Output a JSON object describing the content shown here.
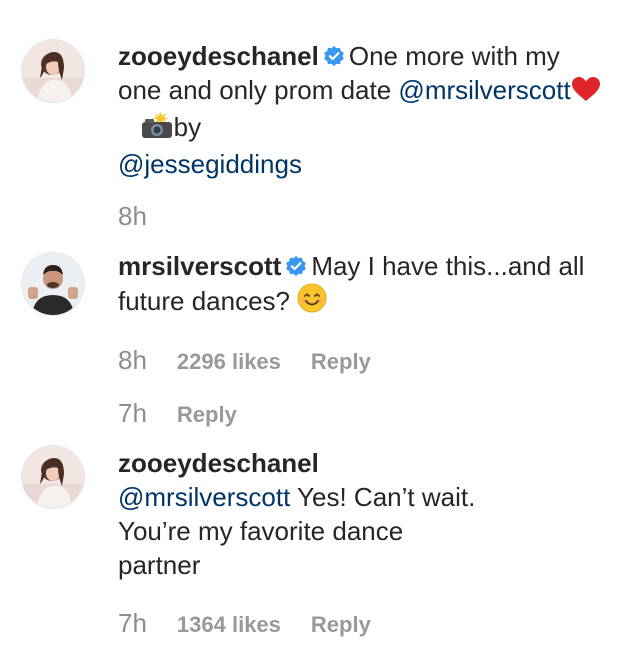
{
  "comments": [
    {
      "username": "zooeydeschanel",
      "verified": true,
      "text_before": "One more with my one and only prom date ",
      "mention": "@mrsilverscott",
      "heart_emoji": "heart-emoji",
      "camera_emoji": "camera-flash-emoji",
      "text_after": "by ",
      "mention2": "@jessegiddings",
      "time": "8h"
    },
    {
      "username": "mrsilverscott",
      "verified": true,
      "text": "May I have this...and all future dances? ",
      "smile_emoji": "smiling-face-emoji",
      "time": "8h",
      "likes": "2296 likes",
      "reply_label": "Reply"
    },
    {
      "time": "7h",
      "reply_label": "Reply"
    },
    {
      "username": "zooeydeschanel",
      "mention": "@mrsilverscott",
      "text": " Yes! Can’t wait. You’re my favorite dance partner",
      "time": "7h",
      "likes": "1364 likes",
      "reply_label": "Reply"
    }
  ],
  "colors": {
    "text": "#262626",
    "mention": "#003569",
    "meta": "#8e8e8e",
    "verified_badge": "#3897f0"
  }
}
